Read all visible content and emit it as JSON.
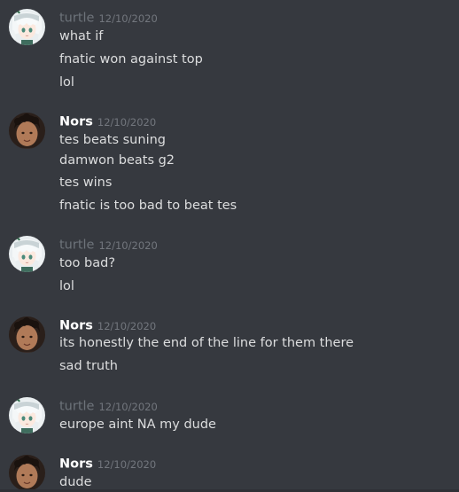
{
  "messages": [
    {
      "author": "turtle",
      "timestamp": "12/10/2020",
      "lines": [
        "what if",
        "fnatic won against top",
        "lol"
      ]
    },
    {
      "author": "Nors",
      "timestamp": "12/10/2020",
      "lines": [
        "tes beats suning",
        "damwon beats g2",
        "tes wins",
        "fnatic is too bad to beat tes"
      ]
    },
    {
      "author": "turtle",
      "timestamp": "12/10/2020",
      "lines": [
        "too bad?",
        "lol"
      ]
    },
    {
      "author": "Nors",
      "timestamp": "12/10/2020",
      "lines": [
        "its honestly the end of the line for them there",
        "sad truth"
      ]
    },
    {
      "author": "turtle",
      "timestamp": "12/10/2020",
      "lines": [
        "europe aint NA my dude"
      ]
    },
    {
      "author": "Nors",
      "timestamp": "12/10/2020",
      "lines": [
        "dude"
      ]
    }
  ],
  "colors": {
    "background": "#36393f",
    "turtle_name": "#6d737a",
    "nors_name": "#ffffff",
    "timestamp": "#72767d",
    "message_text": "#dcddde"
  },
  "icons": {
    "turtle_avatar": "anime-girl-avatar-icon",
    "nors_avatar": "person-photo-avatar-icon"
  }
}
